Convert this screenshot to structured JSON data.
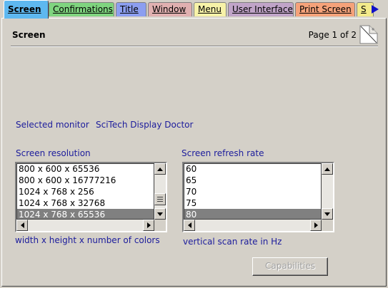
{
  "tabs": [
    {
      "label": "Screen",
      "color": "#5eb8f0",
      "active": true
    },
    {
      "label": "Confirmations",
      "color": "#7fd47f",
      "active": false
    },
    {
      "label": "Title",
      "color": "#8c9ef0",
      "active": false
    },
    {
      "label": "Window",
      "color": "#e0b0b0",
      "active": false
    },
    {
      "label": "Menu",
      "color": "#f7f2a8",
      "active": false
    },
    {
      "label": "User Interface",
      "color": "#c0a4c8",
      "active": false
    },
    {
      "label": "Print Screen",
      "color": "#f5a27a",
      "active": false
    },
    {
      "label": "S",
      "color": "#f2ea8a",
      "active": false
    }
  ],
  "tab_scroll_icon": "play-right-icon",
  "header": {
    "title": "Screen",
    "page_indicator": "Page 1 of 2",
    "page_turn_icon": "page-curl-icon"
  },
  "monitor": {
    "label": "Selected monitor",
    "value": "SciTech Display Doctor"
  },
  "resolution": {
    "label": "Screen resolution",
    "items": [
      "800 x 600 x 65536",
      "800 x 600 x 16777216",
      "1024 x 768 x 256",
      "1024 x 768 x 32768",
      "1024 x 768 x 65536"
    ],
    "selected_index": 4,
    "caption": "width x height x number of colors"
  },
  "refresh": {
    "label": "Screen refresh rate",
    "items": [
      "60",
      "65",
      "70",
      "75",
      "80"
    ],
    "selected_index": 4,
    "caption": "vertical scan rate in Hz"
  },
  "capabilities_button": {
    "label": "Capabilities",
    "enabled": false
  },
  "colors": {
    "label_text": "#1c1c9c",
    "panel_bg": "#d4d0c8",
    "selection_bg": "#808080"
  }
}
